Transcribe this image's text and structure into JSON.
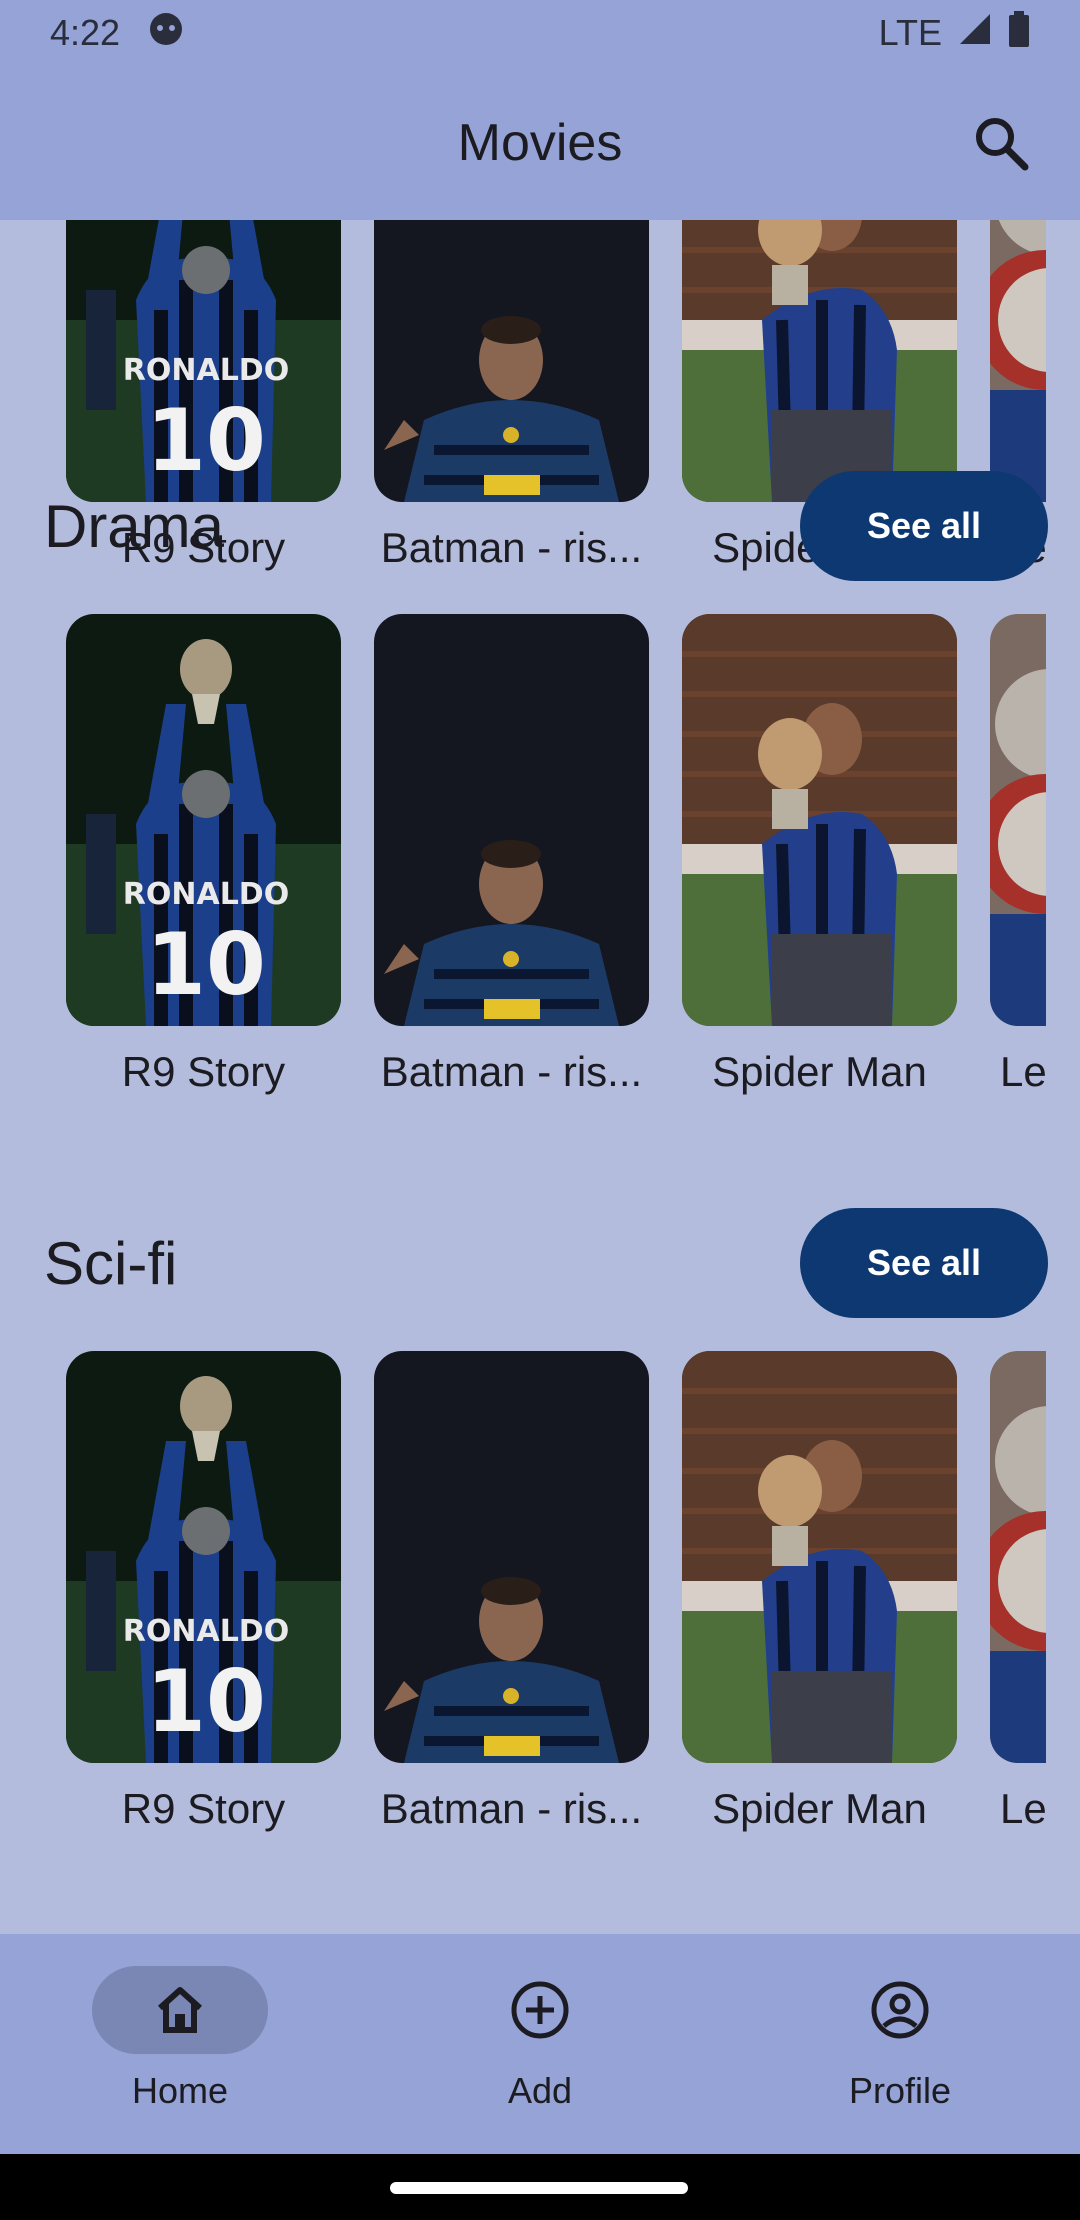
{
  "status_bar": {
    "time": "4:22",
    "network": "LTE"
  },
  "app_bar": {
    "title": "Movies"
  },
  "top_row": {
    "cards": [
      {
        "title": "R9 Story",
        "poster": "ronaldo-back"
      },
      {
        "title": "Batman - ris...",
        "poster": "ronaldo-dark"
      },
      {
        "title": "Spider Man",
        "poster": "ronaldo-kiss"
      },
      {
        "title": "Le",
        "poster": "ronaldo-trophy"
      }
    ]
  },
  "sections": [
    {
      "title": "Drama",
      "see_all": "See all",
      "cards": [
        {
          "title": "R9 Story",
          "poster": "ronaldo-back"
        },
        {
          "title": "Batman - ris...",
          "poster": "ronaldo-dark"
        },
        {
          "title": "Spider Man",
          "poster": "ronaldo-kiss"
        },
        {
          "title": "Le",
          "poster": "ronaldo-trophy"
        }
      ]
    },
    {
      "title": "Sci-fi",
      "see_all": "See all",
      "cards": [
        {
          "title": "R9 Story",
          "poster": "ronaldo-back"
        },
        {
          "title": "Batman - ris...",
          "poster": "ronaldo-dark"
        },
        {
          "title": "Spider Man",
          "poster": "ronaldo-kiss"
        },
        {
          "title": "Le",
          "poster": "ronaldo-trophy"
        }
      ]
    }
  ],
  "bottom_nav": {
    "items": [
      {
        "label": "Home",
        "icon": "home-icon",
        "active": true
      },
      {
        "label": "Add",
        "icon": "add-circle-icon",
        "active": false
      },
      {
        "label": "Profile",
        "icon": "profile-icon",
        "active": false
      }
    ]
  },
  "colors": {
    "background": "#b3bcdc",
    "app_bar": "#95a3d6",
    "button": "#0e3871",
    "nav_active": "#7a87b5"
  }
}
